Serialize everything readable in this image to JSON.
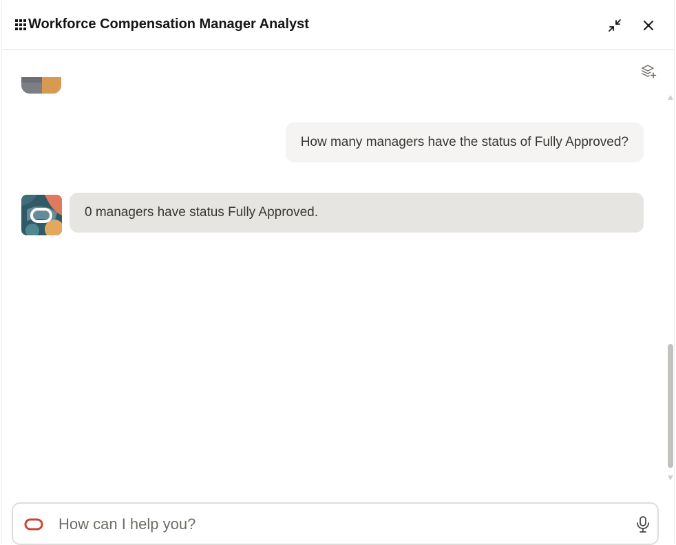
{
  "header": {
    "title": "Workforce Compensation Manager Analyst",
    "icons": {
      "apps": "apps-grid-icon",
      "minimize": "minimize-icon",
      "close": "close-icon"
    }
  },
  "toolbar": {
    "add_icon": "layers-add-icon"
  },
  "messages": [
    {
      "role": "user",
      "text": "How many managers have the status of Fully Approved?"
    },
    {
      "role": "assistant",
      "text": "0 managers have status Fully Approved."
    }
  ],
  "composer": {
    "placeholder": "How can I help you?",
    "value": "",
    "mic_icon": "microphone-icon",
    "brand_icon": "oracle-logo-icon"
  },
  "colors": {
    "brand_red": "#c74634",
    "user_bubble": "#f5f4f2",
    "bot_bubble": "#e7e5e1",
    "scroll_thumb": "#c3c1bd"
  }
}
